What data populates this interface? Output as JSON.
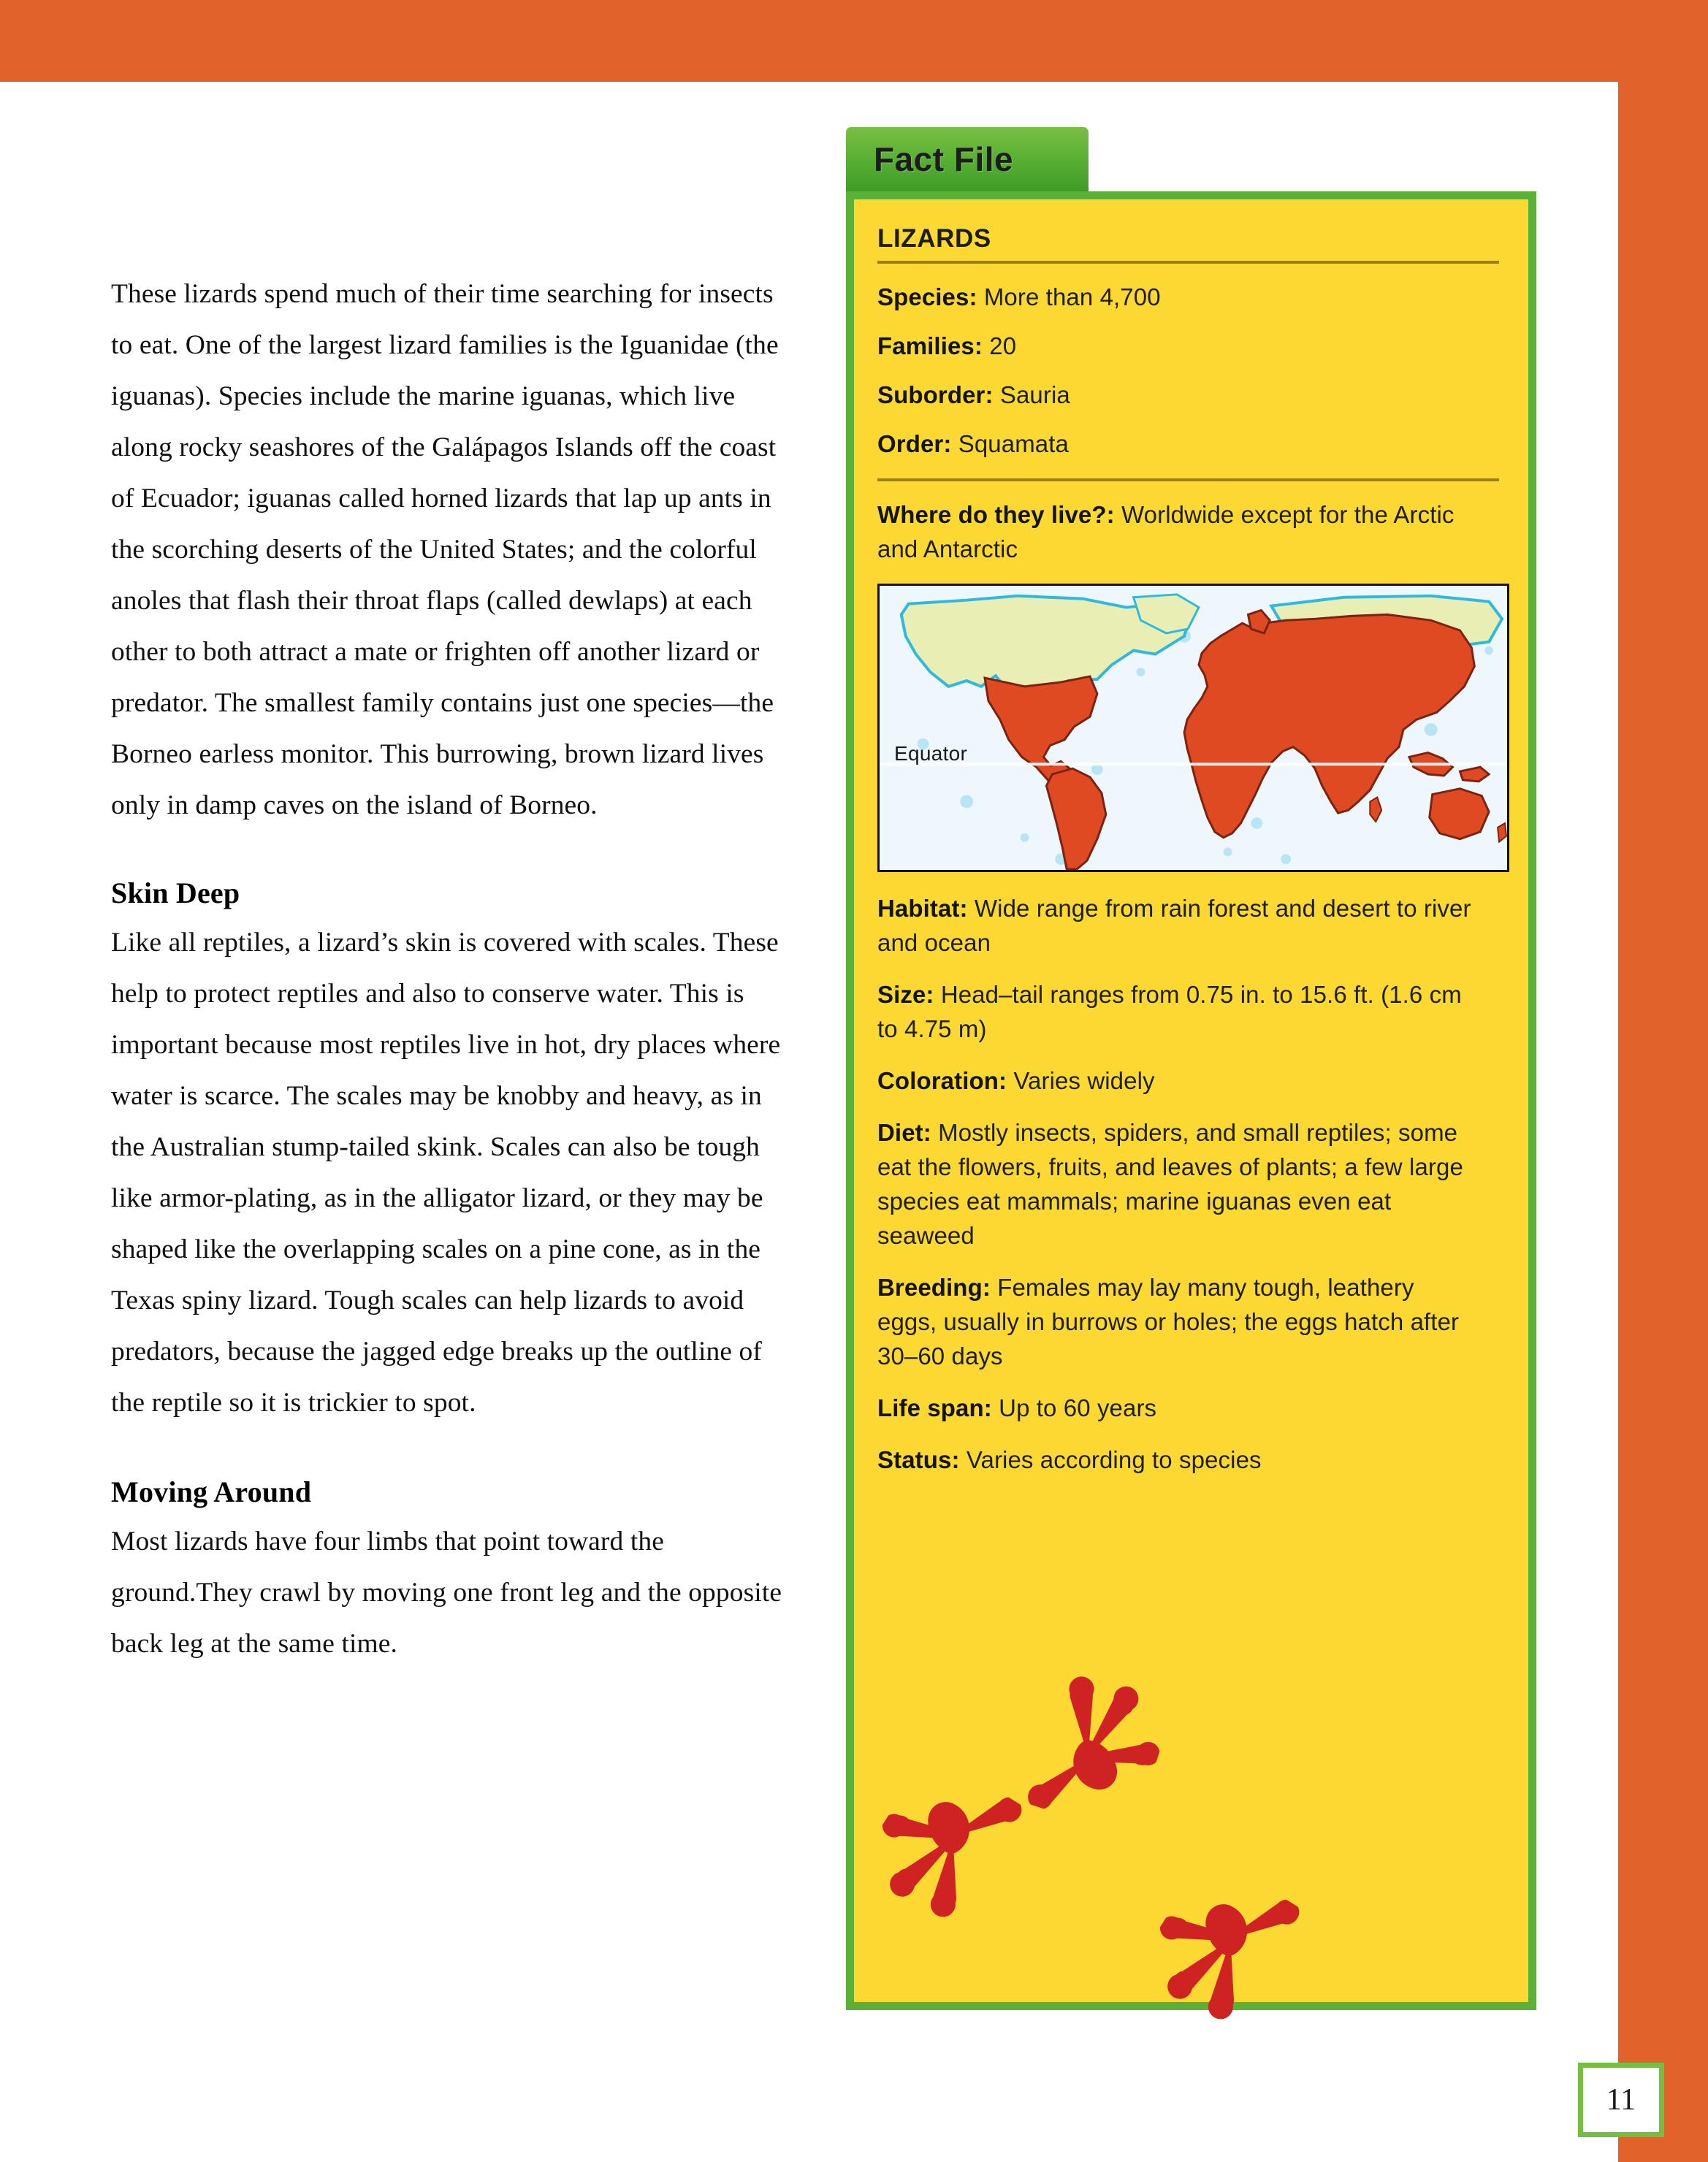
{
  "page": {
    "number": "11",
    "frame_color": "#e2622c"
  },
  "article": {
    "paragraphs": [
      "These lizards spend much of their time searching for insects to eat. One of the largest lizard families is the Iguanidae (the iguanas). Species include the marine iguanas, which live along rocky seashores of the Galápagos Islands off the coast of Ecuador; iguanas called horned lizards that lap up ants in the scorching deserts of the United States; and the colorful anoles that flash their throat flaps (called dewlaps) at each other to both attract a mate or frighten off another lizard or predator. The smallest family contains just one species—the Borneo earless monitor. This burrowing, brown lizard lives only in damp caves on the island of Borneo."
    ],
    "sections": [
      {
        "heading": "Skin Deep",
        "text": "Like all reptiles, a lizard’s skin is covered with scales. These help to protect reptiles and also to conserve water. This is important because most reptiles live in hot, dry places where water is scarce. The scales may be knobby and heavy, as in the Australian stump-tailed skink. Scales can also be tough like armor-plating, as in the alligator lizard, or they may be shaped like the overlapping scales on a pine cone, as in the Texas spiny lizard. Tough scales can help lizards to avoid predators, because the jagged edge breaks up the outline of the reptile so it is trickier to spot."
      },
      {
        "heading": "Moving Around",
        "text": "Most lizards have four limbs that point toward the ground.They crawl by moving one front leg and the opposite back leg at the same time."
      }
    ]
  },
  "fact_file": {
    "tab_label": "Fact File",
    "title": "LIZARDS",
    "tab_color": "#57ad32",
    "panel_color": "#fcd832",
    "border_color": "#5bb037",
    "rule_color": "#9c7d10",
    "taxonomy": [
      {
        "label": "Species:",
        "value": "More than 4,700"
      },
      {
        "label": "Families:",
        "value": "20"
      },
      {
        "label": "Suborder:",
        "value": "Sauria"
      },
      {
        "label": "Order:",
        "value": "Squamata"
      }
    ],
    "where": {
      "label": "Where do they live?:",
      "value": "Worldwide except for the Arctic and Antarctic"
    },
    "map": {
      "equator_label": "Equator",
      "range_color": "#e04a22",
      "non_range_color": "#e9eeb4",
      "ocean_color": "#eef8fc"
    },
    "details": [
      {
        "label": "Habitat:",
        "value": "Wide range from rain forest and desert to river and ocean"
      },
      {
        "label": "Size:",
        "value": "Head–tail ranges from 0.75 in. to 15.6 ft. (1.6 cm to 4.75 m)"
      },
      {
        "label": "Coloration:",
        "value": "Varies widely"
      },
      {
        "label": "Diet:",
        "value": "Mostly insects, spiders, and small reptiles; some eat the flowers, fruits, and leaves of plants; a few large species eat mammals; marine iguanas even eat seaweed"
      },
      {
        "label": "Breeding:",
        "value": "Females may lay many tough, leathery eggs, usually in burrows or holes; the eggs hatch after 30–60 days"
      },
      {
        "label": "Life span:",
        "value": "Up to 60 years"
      },
      {
        "label": "Status:",
        "value": "Varies according to species"
      }
    ],
    "footprints": {
      "color": "#cf2222",
      "count": 3
    }
  }
}
